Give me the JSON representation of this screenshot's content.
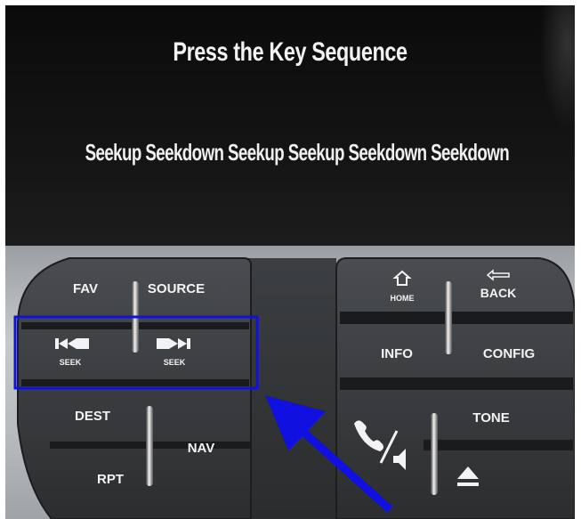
{
  "screen": {
    "title": "Press the Key Sequence",
    "sequence_text": "Seekup Seekdown Seekup Seekup Seekdown Seekdown"
  },
  "console": {
    "left_cluster": {
      "fav": "FAV",
      "source": "SOURCE",
      "seek_back_label": "SEEK",
      "seek_fwd_label": "SEEK",
      "dest": "DEST",
      "nav": "NAV",
      "rpt": "RPT"
    },
    "right_cluster": {
      "home": "HOME",
      "back": "BACK",
      "info": "INFO",
      "config": "CONFIG",
      "tone": "TONE"
    }
  },
  "annotation": {
    "highlight_color": "#1010e0",
    "arrow_color": "#1010e0"
  }
}
